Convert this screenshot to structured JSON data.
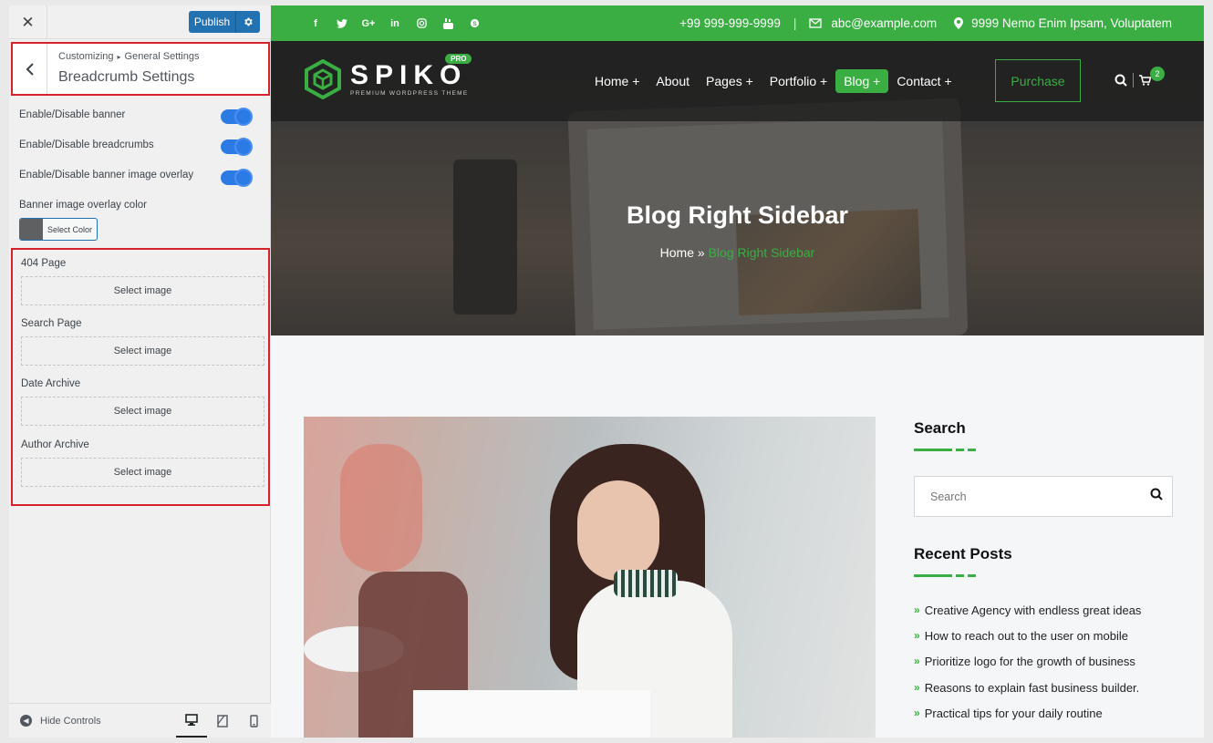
{
  "customizer": {
    "publish_label": "Publish",
    "breadcrumb": {
      "root": "Customizing",
      "separator": "▸",
      "parent": "General Settings"
    },
    "section_title": "Breadcrumb Settings",
    "controls": [
      {
        "label": "Enable/Disable banner",
        "enabled": true
      },
      {
        "label": "Enable/Disable breadcrumbs",
        "enabled": true
      },
      {
        "label": "Enable/Disable banner image overlay",
        "enabled": true
      }
    ],
    "overlay_color_label": "Banner image overlay color",
    "overlay_color_button": "Select Color",
    "overlay_color_value": "#5f6062",
    "image_controls": [
      {
        "label": "404 Page",
        "button": "Select image"
      },
      {
        "label": "Search Page",
        "button": "Select image"
      },
      {
        "label": "Date Archive",
        "button": "Select image"
      },
      {
        "label": "Author Archive",
        "button": "Select image"
      }
    ],
    "footer": {
      "hide_controls": "Hide Controls",
      "devices": [
        "desktop-icon",
        "tablet-icon",
        "mobile-icon"
      ],
      "active_device": "desktop"
    }
  },
  "site": {
    "accent_color": "#3aae43",
    "topbar": {
      "social": [
        "facebook-icon",
        "twitter-icon",
        "google-plus-icon",
        "linkedin-icon",
        "instagram-icon",
        "youtube-icon",
        "skype-icon"
      ],
      "phone": "+99 999-999-9999",
      "divider": "|",
      "email": "abc@example.com",
      "address": "9999 Nemo Enim Ipsam, Voluptatem"
    },
    "logo": {
      "name": "SPIKO",
      "tagline": "PREMIUM WORDPRESS THEME",
      "badge": "PRO"
    },
    "menu": [
      "Home +",
      "About",
      "Pages +",
      "Portfolio +",
      "Blog +",
      "Contact +"
    ],
    "active_menu": "Blog +",
    "purchase_label": "Purchase",
    "cart_count": "2",
    "banner": {
      "title": "Blog Right Sidebar",
      "crumb_home": "Home",
      "crumb_sep": " » ",
      "crumb_current": "Blog Right Sidebar"
    },
    "sidebar": {
      "search_title": "Search",
      "search_placeholder": "Search",
      "recent_title": "Recent Posts",
      "recent_posts": [
        "Creative Agency with endless great ideas",
        "How to reach out to the user on mobile",
        "Prioritize logo for the growth of business",
        "Reasons to explain fast business builder.",
        "Practical tips for your daily routine"
      ]
    }
  }
}
